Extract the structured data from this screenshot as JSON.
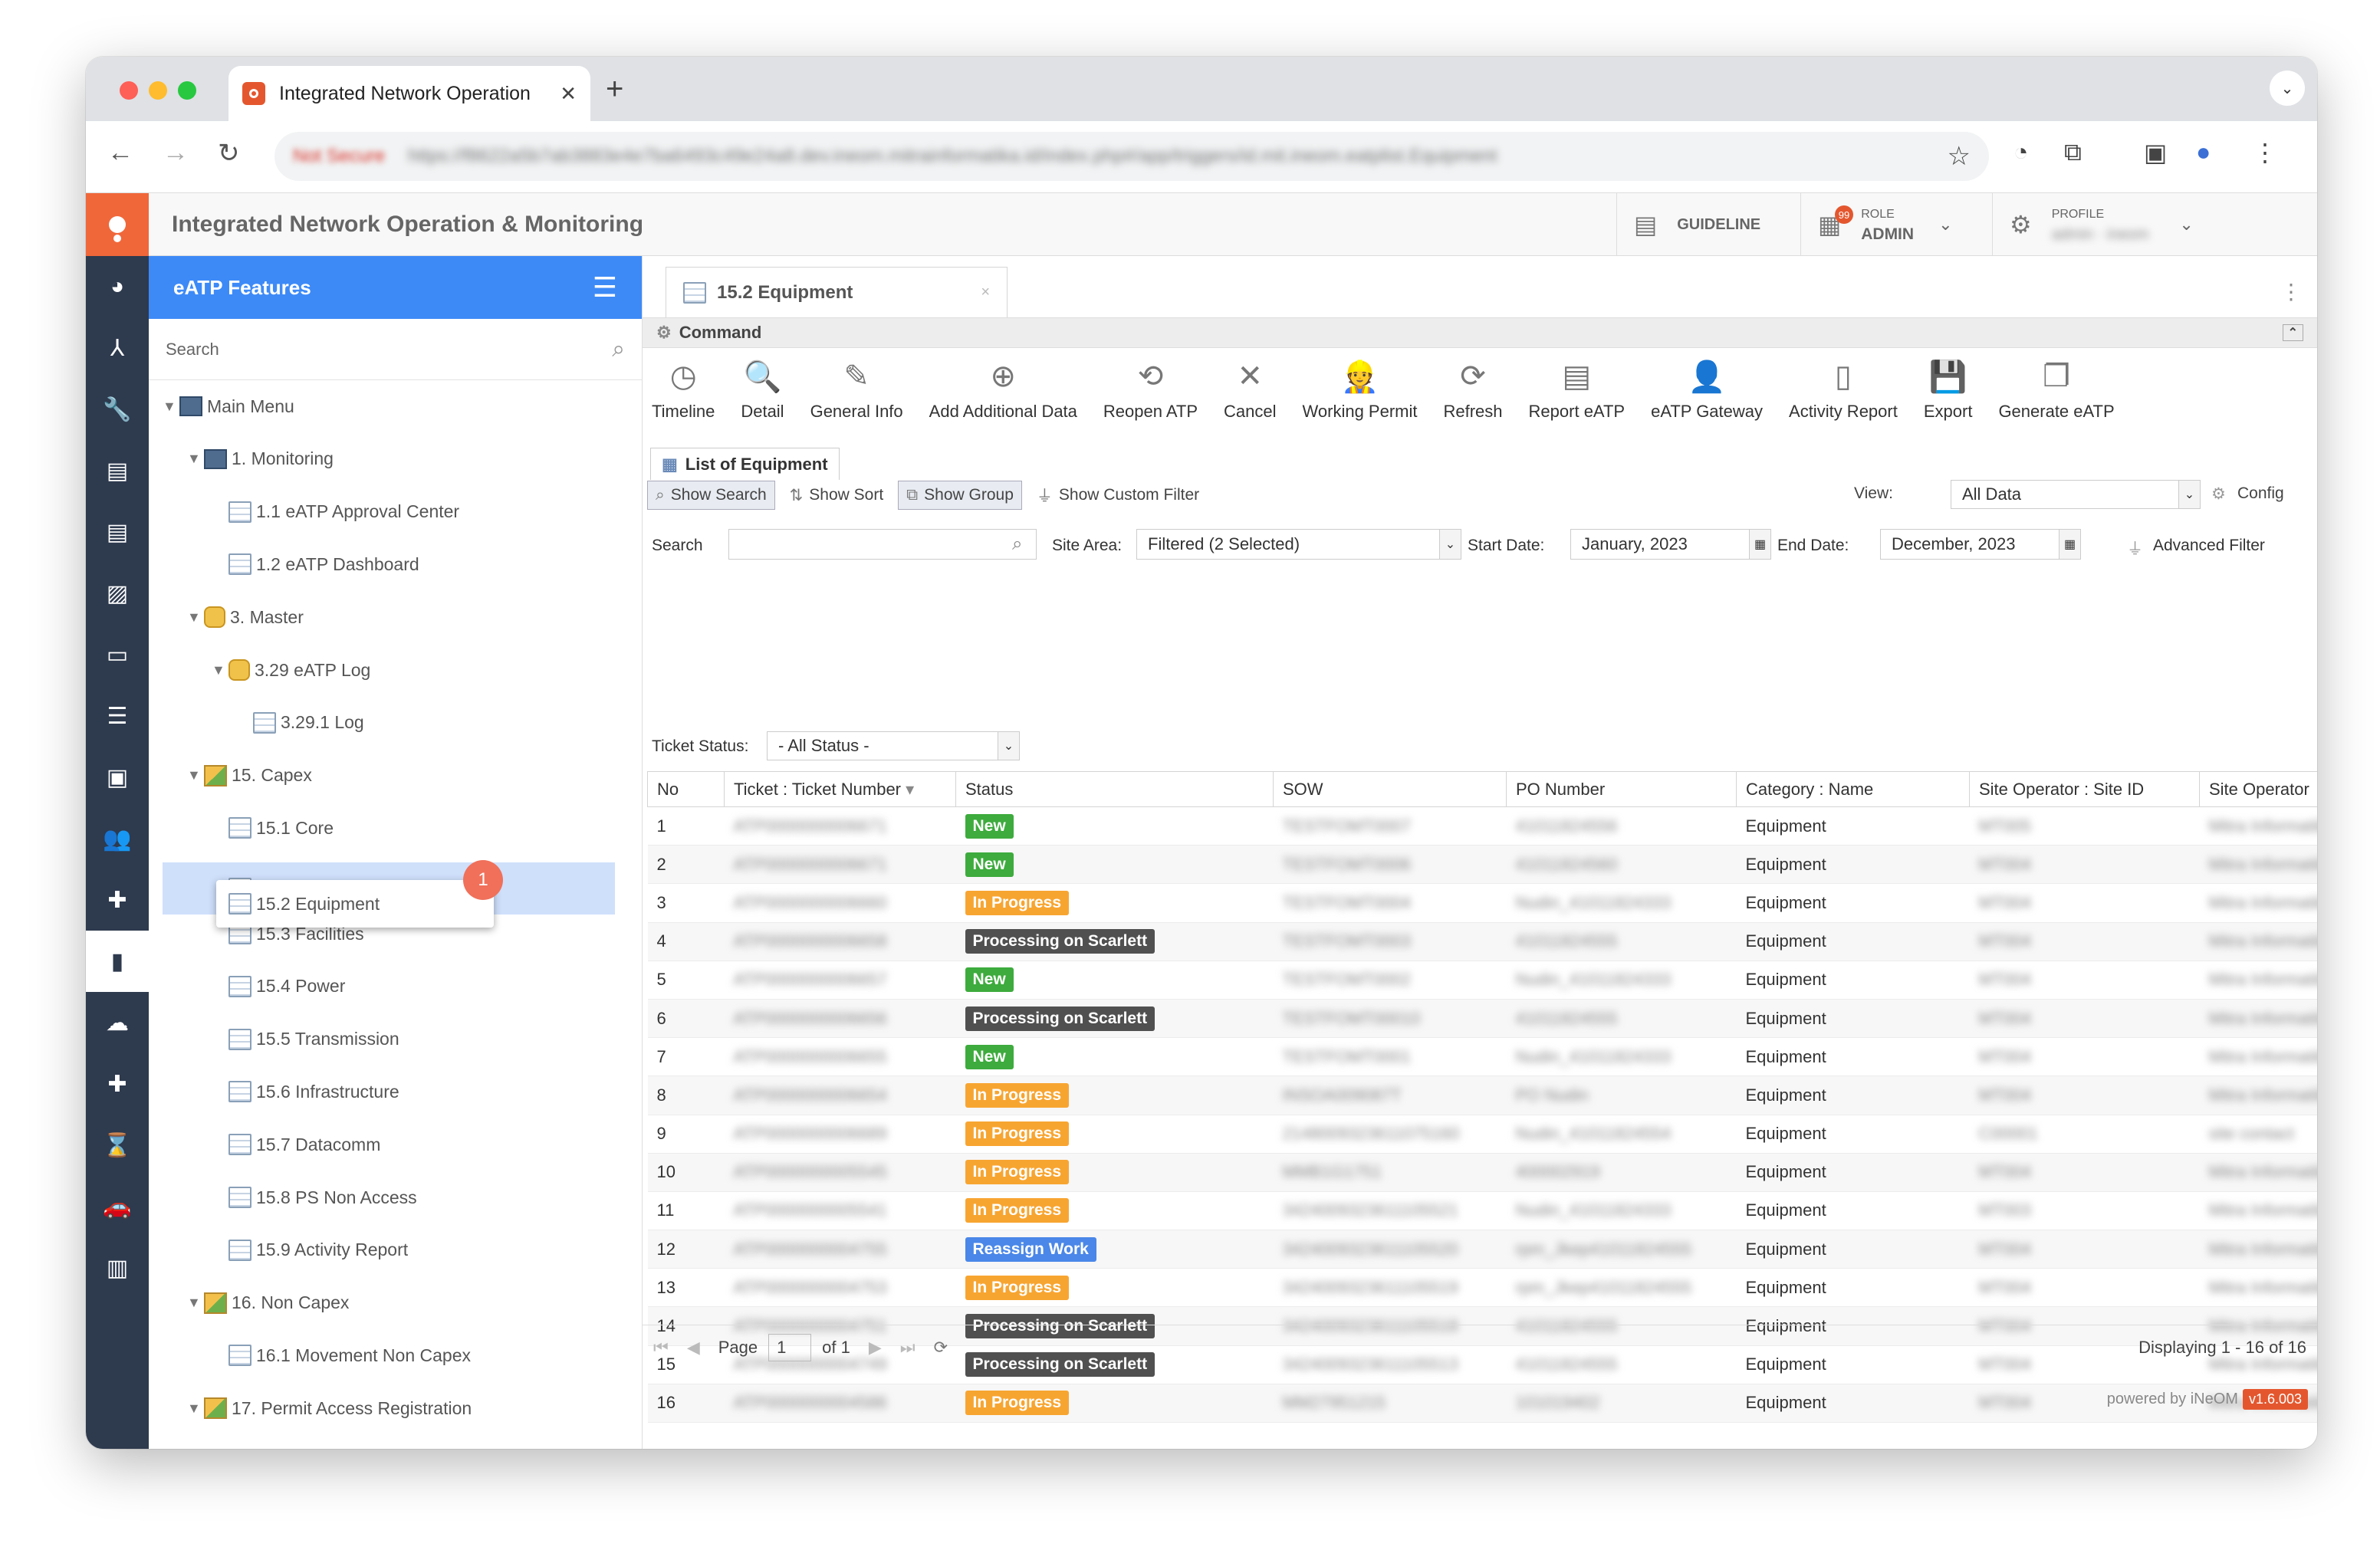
{
  "browser": {
    "tab_title": "Integrated Network Operation",
    "url_security": "Not Secure",
    "url": "https://f8622a5b7ab3883e4e7ba6493c49e24a8.dev.ineom.mitrainformatika.id/index.php#/app/triggers/id.mit.ineom.eatplist.Equipment"
  },
  "header": {
    "title": "Integrated Network Operation & Monitoring",
    "guideline": "GUIDELINE",
    "role_label": "ROLE",
    "role_value": "ADMIN",
    "notif_count": "99",
    "profile_label": "PROFILE",
    "profile_value": "admin · ineom"
  },
  "sidebar": {
    "title": "eATP Features",
    "search_placeholder": "Search",
    "tree": [
      {
        "label": "Main Menu",
        "icon": "folder-icon",
        "level": 0,
        "caret": true
      },
      {
        "label": "1. Monitoring",
        "icon": "monitor-icon",
        "level": 1,
        "caret": true
      },
      {
        "label": "1.1 eATP Approval Center",
        "icon": "doc-icon",
        "level": 2
      },
      {
        "label": "1.2 eATP Dashboard",
        "icon": "doc-icon",
        "level": 2
      },
      {
        "label": "3. Master",
        "icon": "database-icon",
        "level": 1,
        "caret": true
      },
      {
        "label": "3.29 eATP Log",
        "icon": "database-icon",
        "level": 2,
        "caret": true
      },
      {
        "label": "3.29.1 Log",
        "icon": "doc-icon",
        "level": 3
      },
      {
        "label": "15. Capex",
        "icon": "package-icon",
        "level": 1,
        "caret": true
      },
      {
        "label": "15.1 Core",
        "icon": "doc-icon",
        "level": 2
      },
      {
        "label": "15.2 Equipment",
        "icon": "doc-icon",
        "level": 2,
        "selected": true
      },
      {
        "label": "15.3 Facilities",
        "icon": "doc-icon",
        "level": 2
      },
      {
        "label": "15.4 Power",
        "icon": "doc-icon",
        "level": 2
      },
      {
        "label": "15.5 Transmission",
        "icon": "doc-icon",
        "level": 2
      },
      {
        "label": "15.6 Infrastructure",
        "icon": "doc-icon",
        "level": 2
      },
      {
        "label": "15.7 Datacomm",
        "icon": "doc-icon",
        "level": 2
      },
      {
        "label": "15.8 PS Non Access",
        "icon": "doc-icon",
        "level": 2
      },
      {
        "label": "15.9 Activity Report",
        "icon": "doc-icon",
        "level": 2
      },
      {
        "label": "16. Non Capex",
        "icon": "package-icon",
        "level": 1,
        "caret": true
      },
      {
        "label": "16.1 Movement Non Capex",
        "icon": "doc-icon",
        "level": 2
      },
      {
        "label": "17. Permit Access Registration",
        "icon": "package-icon",
        "level": 1,
        "caret": true
      }
    ],
    "marker": "1"
  },
  "page_tab": {
    "label": "15.2 Equipment",
    "close": "×"
  },
  "command": {
    "label": "Command",
    "buttons": [
      {
        "label": "Timeline",
        "icon": "clock-icon",
        "glyph": "◷"
      },
      {
        "label": "Detail",
        "icon": "magnifier-doc-icon",
        "glyph": "🔍"
      },
      {
        "label": "General Info",
        "icon": "edit-doc-icon",
        "glyph": "✎"
      },
      {
        "label": "Add Additional Data",
        "icon": "add-doc-icon",
        "glyph": "⊕"
      },
      {
        "label": "Reopen ATP",
        "icon": "reopen-icon",
        "glyph": "⟲"
      },
      {
        "label": "Cancel",
        "icon": "cancel-icon",
        "glyph": "✕"
      },
      {
        "label": "Working Permit",
        "icon": "worker-icon",
        "glyph": "👷"
      },
      {
        "label": "Refresh",
        "icon": "refresh-icon",
        "glyph": "⟳"
      },
      {
        "label": "Report eATP",
        "icon": "pdf-icon",
        "glyph": "▤"
      },
      {
        "label": "eATP Gateway",
        "icon": "gateway-user-icon",
        "glyph": "👤"
      },
      {
        "label": "Activity Report",
        "icon": "activity-report-icon",
        "glyph": "▯"
      },
      {
        "label": "Export",
        "icon": "export-icon",
        "glyph": "💾"
      },
      {
        "label": "Generate eATP",
        "icon": "generate-icon",
        "glyph": "❐"
      }
    ]
  },
  "list": {
    "title": "List of Equipment",
    "show_search": "Show Search",
    "show_sort": "Show Sort",
    "show_group": "Show Group",
    "show_custom_filter": "Show Custom Filter",
    "view_label": "View:",
    "view_value": "All Data",
    "config": "Config"
  },
  "filters": {
    "search_label": "Search",
    "site_area_label": "Site Area:",
    "site_area_value": "Filtered  (2 Selected)",
    "start_label": "Start Date:",
    "start_value": "January, 2023",
    "end_label": "End Date:",
    "end_value": "December, 2023",
    "advanced": "Advanced Filter",
    "ticket_status_label": "Ticket Status:",
    "ticket_status_value": "- All Status -"
  },
  "table": {
    "columns": [
      "No",
      "Ticket : Ticket Number",
      "Status",
      "SOW",
      "PO Number",
      "Category : Name",
      "Site Operator : Site ID",
      "Site Operator"
    ],
    "rows": [
      {
        "no": "1",
        "ticket": "ATP0000000006671",
        "status": "New",
        "sow": "TESTFOMT0007",
        "po": "41011824556",
        "cat": "Equipment",
        "site": "MT005",
        "op": "Mitra Informatika"
      },
      {
        "no": "2",
        "ticket": "ATP0000000006671",
        "status": "New",
        "sow": "TESTFOMT0006",
        "po": "41011824560",
        "cat": "Equipment",
        "site": "MT004",
        "op": "Mitra Informatika"
      },
      {
        "no": "3",
        "ticket": "ATP0000000006660",
        "status": "In Progress",
        "sow": "TESTFOMT0004",
        "po": "Nudin_41011824333",
        "cat": "Equipment",
        "site": "MT004",
        "op": "Mitra Informatika"
      },
      {
        "no": "4",
        "ticket": "ATP0000000006658",
        "status": "Processing on Scarlett",
        "sow": "TESTFOMT0003",
        "po": "41011824555",
        "cat": "Equipment",
        "site": "MT004",
        "op": "Mitra Informatika"
      },
      {
        "no": "5",
        "ticket": "ATP0000000006657",
        "status": "New",
        "sow": "TESTFOMT0002",
        "po": "Nudin_41011824333",
        "cat": "Equipment",
        "site": "MT004",
        "op": "Mitra Informatika"
      },
      {
        "no": "6",
        "ticket": "ATP0000000006656",
        "status": "Processing on Scarlett",
        "sow": "TESTFOMT00010",
        "po": "41011824555",
        "cat": "Equipment",
        "site": "MT004",
        "op": "Mitra Informatika"
      },
      {
        "no": "7",
        "ticket": "ATP0000000006655",
        "status": "New",
        "sow": "TESTFOMT0001",
        "po": "Nudin_41011824333",
        "cat": "Equipment",
        "site": "MT004",
        "op": "Mitra Informatika"
      },
      {
        "no": "8",
        "ticket": "ATP0000000006654",
        "status": "In Progress",
        "sow": "INSOA009087T",
        "po": "PO Nudin",
        "cat": "Equipment",
        "site": "MT004",
        "op": "Mitra Informatika"
      },
      {
        "no": "9",
        "ticket": "ATP0000000006689",
        "status": "In Progress",
        "sow": "2148009323611075160",
        "po": "Nudin_41011824554",
        "cat": "Equipment",
        "site": "C00001",
        "op": "site contact"
      },
      {
        "no": "10",
        "ticket": "ATP0000000005545",
        "status": "In Progress",
        "sow": "MMB1G1751",
        "po": "400002919",
        "cat": "Equipment",
        "site": "MT004",
        "op": "Mitra Informatika"
      },
      {
        "no": "11",
        "ticket": "ATP0000000005541",
        "status": "In Progress",
        "sow": "3424009323611105521",
        "po": "Nudin_41011824333",
        "cat": "Equipment",
        "site": "MT003",
        "op": "Mitra Informatika"
      },
      {
        "no": "12",
        "ticket": "ATP0000000004755",
        "status": "Reassign Work",
        "sow": "3424009323611105520",
        "po": "rpm_Jkep41011824555",
        "cat": "Equipment",
        "site": "MT004",
        "op": "Mitra Informatika"
      },
      {
        "no": "13",
        "ticket": "ATP0000000004753",
        "status": "In Progress",
        "sow": "3424009323611105519",
        "po": "rpm_Jkep41011824555",
        "cat": "Equipment",
        "site": "MT004",
        "op": "Mitra Informatika"
      },
      {
        "no": "14",
        "ticket": "ATP0000000004751",
        "status": "Processing on Scarlett",
        "sow": "3424009323611105518",
        "po": "41011824555",
        "cat": "Equipment",
        "site": "MT004",
        "op": "Mitra Informatika"
      },
      {
        "no": "15",
        "ticket": "ATP0000000004749",
        "status": "Processing on Scarlett",
        "sow": "3424009323611105513",
        "po": "41011824555",
        "cat": "Equipment",
        "site": "MT004",
        "op": "Mitra Informatika"
      },
      {
        "no": "16",
        "ticket": "ATP0000000004586",
        "status": "In Progress",
        "sow": "MM27951215",
        "po": "101019402",
        "cat": "Equipment",
        "site": "MT004",
        "op": "Mitra Informatika"
      }
    ]
  },
  "status_colors": {
    "New": "#3dab3d",
    "In Progress": "#f7a531",
    "Processing on Scarlett": "#505050",
    "Reassign Work": "#4a87e8"
  },
  "pager": {
    "page_label": "Page",
    "page_value": "1",
    "of_label": "of 1",
    "displaying": "Displaying 1 - 16 of 16",
    "powered": "powered by iNeOM",
    "version": "v1.6.003"
  }
}
